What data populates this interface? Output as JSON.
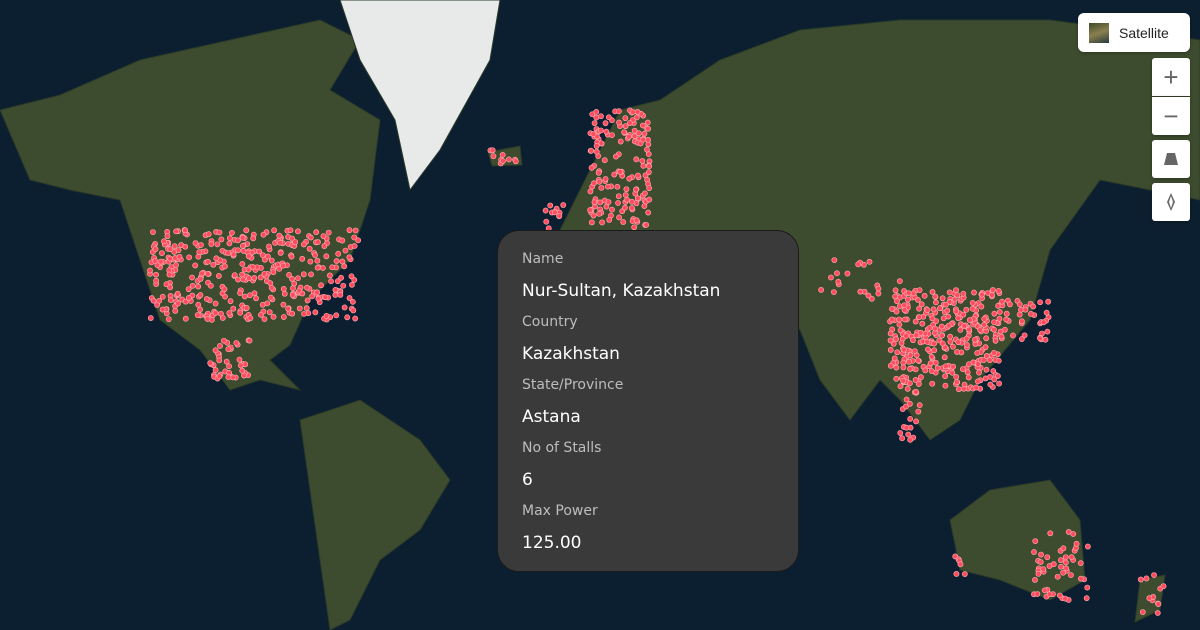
{
  "map_controls": {
    "style_label": "Satellite",
    "zoom_in": "+",
    "zoom_out": "−",
    "icons": [
      "satellite-thumbnail-icon",
      "zoom-in-icon",
      "zoom-out-icon",
      "pitch-icon",
      "compass-icon"
    ]
  },
  "marker_color": "#ff4d5e",
  "popup": {
    "fields": [
      {
        "label": "Name",
        "value": "Nur-Sultan, Kazakhstan"
      },
      {
        "label": "Country",
        "value": "Kazakhstan"
      },
      {
        "label": "State/Province",
        "value": "Astana"
      },
      {
        "label": "No of Stalls",
        "value": "6"
      },
      {
        "label": "Max Power",
        "value": "125.00"
      }
    ]
  }
}
